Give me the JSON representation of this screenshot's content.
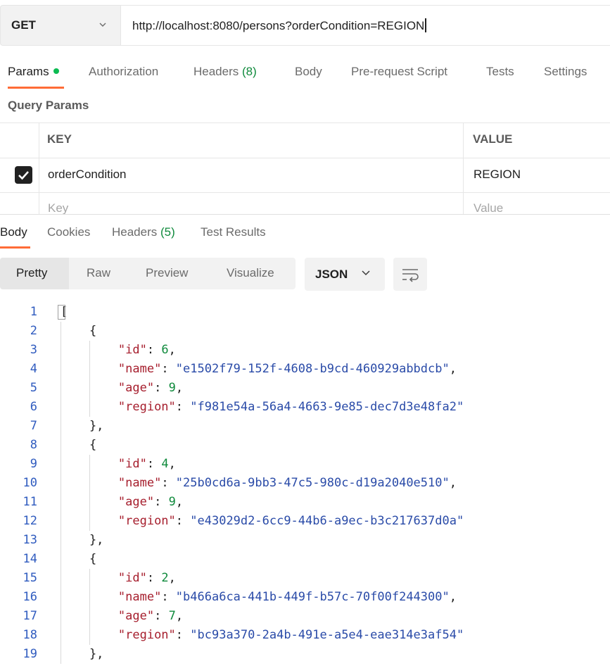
{
  "request": {
    "method": "GET",
    "url": "http://localhost:8080/persons?orderCondition=REGION"
  },
  "request_tabs": [
    {
      "label": "Params",
      "active": true,
      "has_dot": true
    },
    {
      "label": "Authorization"
    },
    {
      "label": "Headers",
      "count": "(8)"
    },
    {
      "label": "Body"
    },
    {
      "label": "Pre-request Script"
    },
    {
      "label": "Tests"
    },
    {
      "label": "Settings"
    }
  ],
  "query_params": {
    "title": "Query Params",
    "columns": [
      "KEY",
      "VALUE"
    ],
    "rows": [
      {
        "checked": true,
        "key": "orderCondition",
        "value": "REGION"
      }
    ],
    "placeholder": {
      "key": "Key",
      "value": "Value"
    }
  },
  "response_tabs": [
    {
      "label": "Body",
      "active": true
    },
    {
      "label": "Cookies"
    },
    {
      "label": "Headers",
      "count": "(5)"
    },
    {
      "label": "Test Results"
    }
  ],
  "view_modes": [
    "Pretty",
    "Raw",
    "Preview",
    "Visualize"
  ],
  "active_view_mode": "Pretty",
  "format": "JSON",
  "icons": {
    "method_dropdown": "chevron-down-icon",
    "format_dropdown": "chevron-down-icon",
    "wrap": "wrap-lines-icon",
    "checkbox": "check-icon"
  },
  "colors": {
    "accent": "#ff6c37",
    "status_dot": "#0cbb52",
    "count": "#0f8a3c"
  },
  "code_lines": [
    {
      "n": "1",
      "text": "["
    },
    {
      "n": "2",
      "text": "    {"
    },
    {
      "n": "3",
      "text": "        \"id\": 6,"
    },
    {
      "n": "4",
      "text": "        \"name\": \"e1502f79-152f-4608-b9cd-460929abbdcb\","
    },
    {
      "n": "5",
      "text": "        \"age\": 9,"
    },
    {
      "n": "6",
      "text": "        \"region\": \"f981e54a-56a4-4663-9e85-dec7d3e48fa2\""
    },
    {
      "n": "7",
      "text": "    },"
    },
    {
      "n": "8",
      "text": "    {"
    },
    {
      "n": "9",
      "text": "        \"id\": 4,"
    },
    {
      "n": "10",
      "text": "        \"name\": \"25b0cd6a-9bb3-47c5-980c-d19a2040e510\","
    },
    {
      "n": "11",
      "text": "        \"age\": 9,"
    },
    {
      "n": "12",
      "text": "        \"region\": \"e43029d2-6cc9-44b6-a9ec-b3c217637d0a\""
    },
    {
      "n": "13",
      "text": "    },"
    },
    {
      "n": "14",
      "text": "    {"
    },
    {
      "n": "15",
      "text": "        \"id\": 2,"
    },
    {
      "n": "16",
      "text": "        \"name\": \"b466a6ca-441b-449f-b57c-70f00f244300\","
    },
    {
      "n": "17",
      "text": "        \"age\": 7,"
    },
    {
      "n": "18",
      "text": "        \"region\": \"bc93a370-2a4b-491e-a5e4-eae314e3af54\""
    },
    {
      "n": "19",
      "text": "    },"
    }
  ]
}
